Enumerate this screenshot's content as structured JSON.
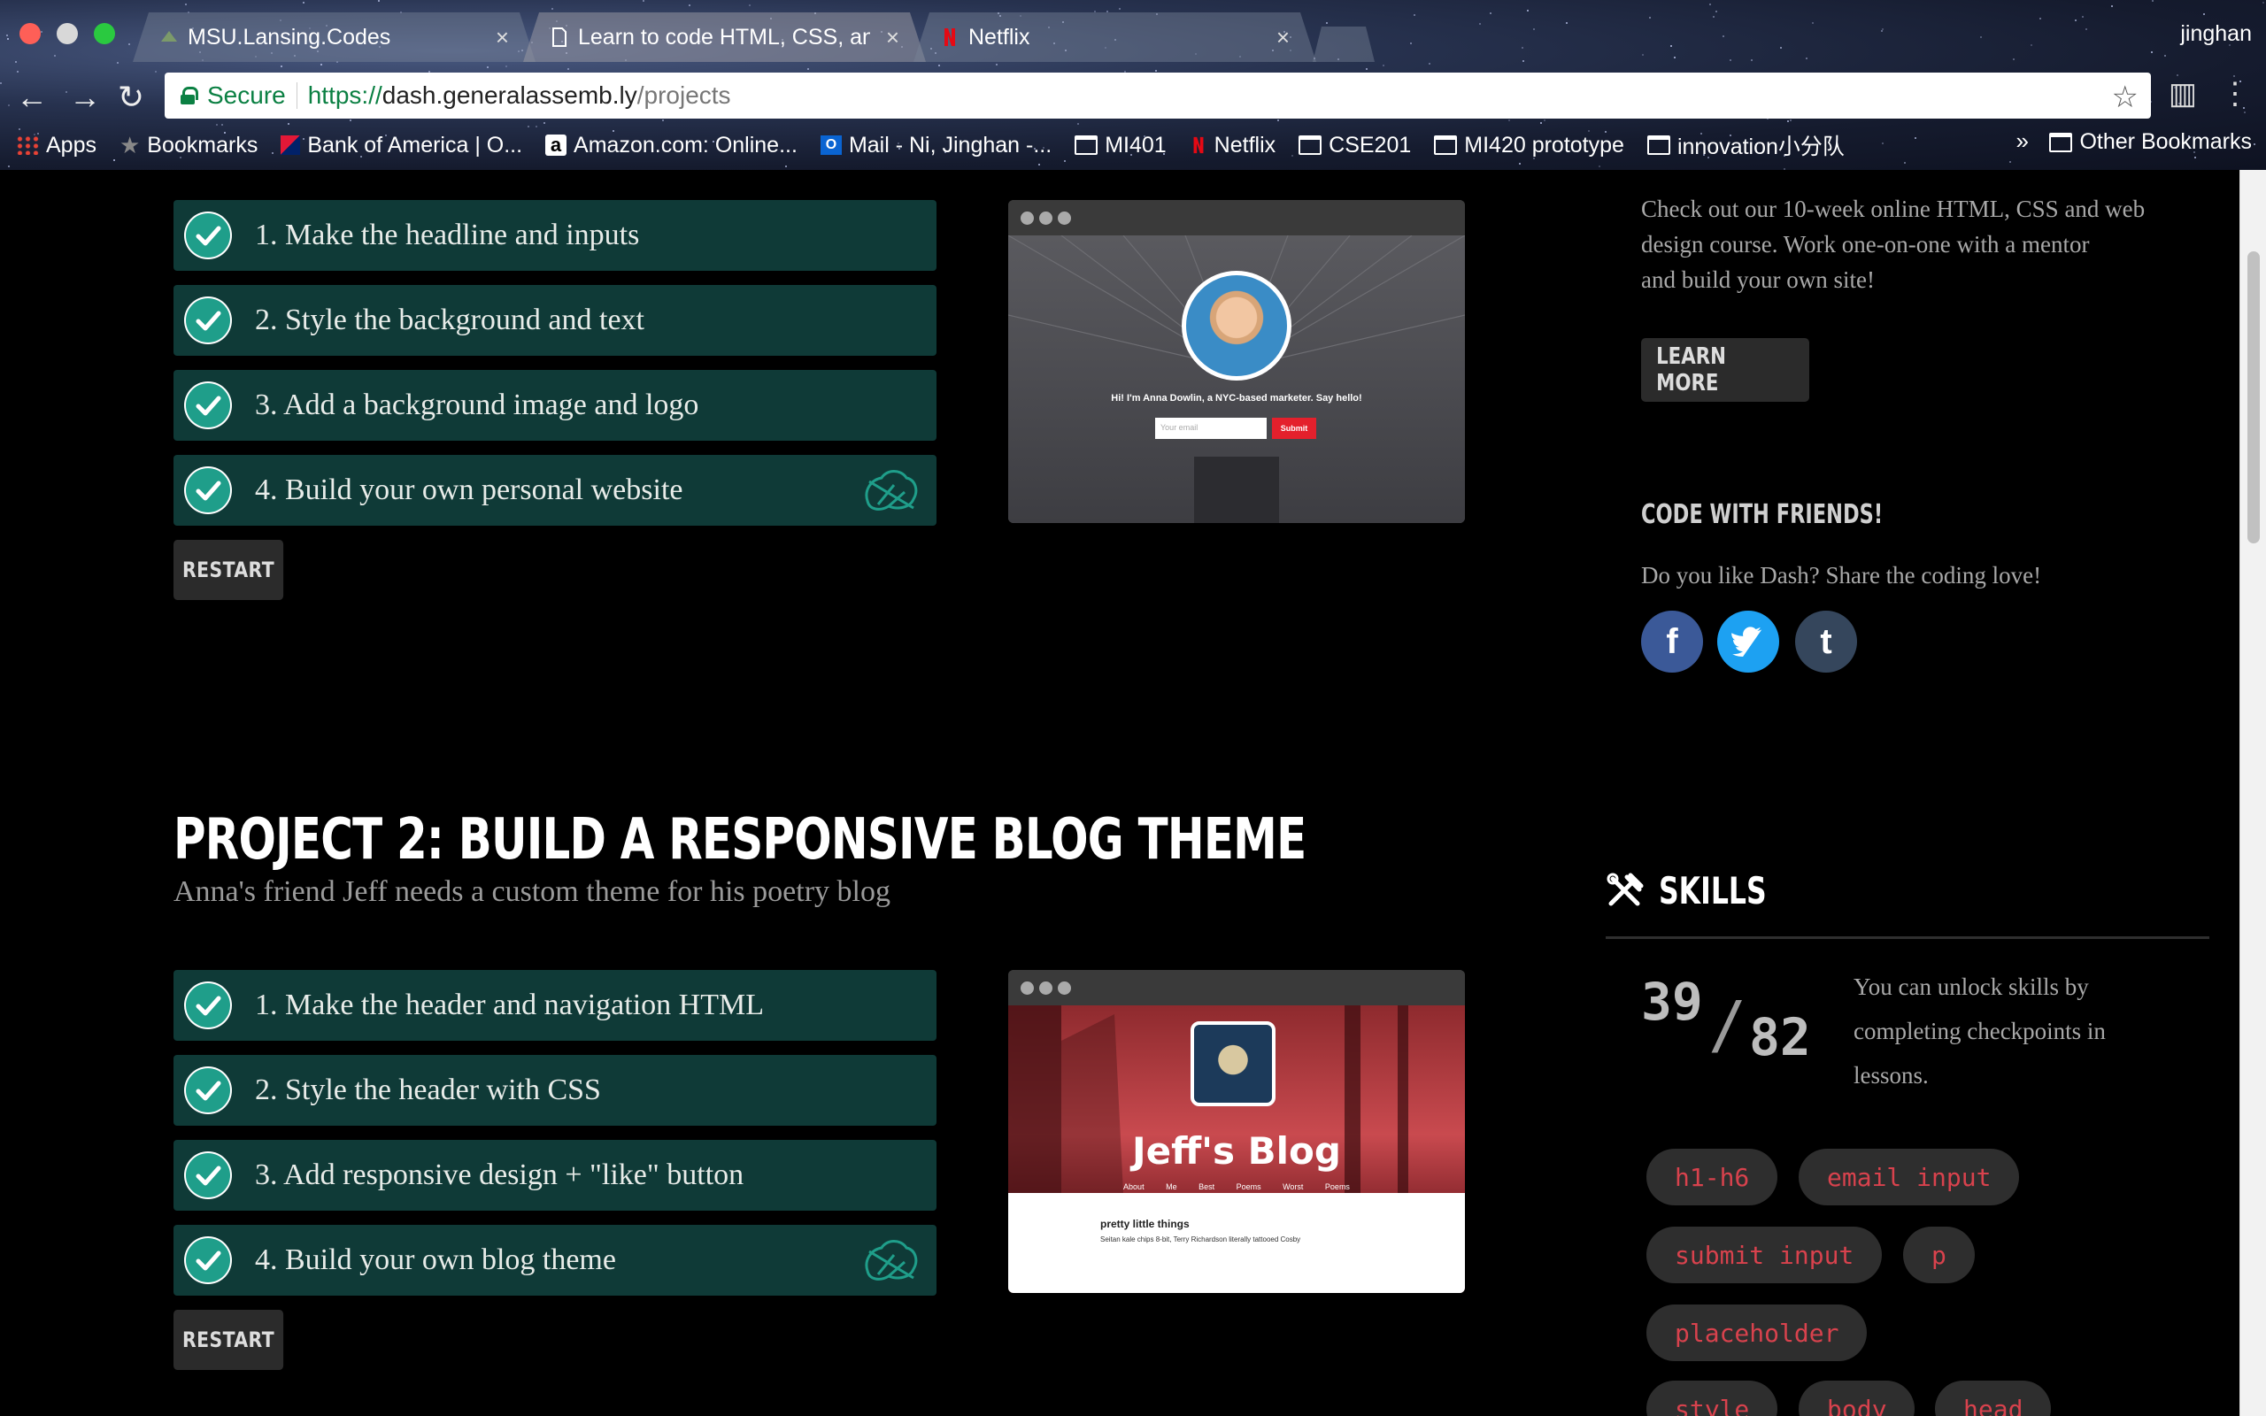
{
  "browser": {
    "user": "jinghan",
    "tabs": [
      {
        "title": "MSU.Lansing.Codes",
        "icon": "site-favicon"
      },
      {
        "title": "Learn to code HTML, CSS, and JavaScript",
        "icon": "document-icon"
      },
      {
        "title": "Netflix",
        "icon": "netflix-icon"
      }
    ],
    "url": {
      "secure_label": "Secure",
      "scheme": "https://",
      "host": "dash.generalassemb.ly",
      "path": "/projects"
    },
    "bookmarks": [
      {
        "label": "Apps",
        "icon": "apps-grid-icon"
      },
      {
        "label": "Bookmarks",
        "icon": "star-icon"
      },
      {
        "label": "Bank of America | O...",
        "icon": "bank-icon"
      },
      {
        "label": "Amazon.com: Online...",
        "icon": "amazon-icon"
      },
      {
        "label": "Mail - Ni, Jinghan -...",
        "icon": "outlook-icon"
      },
      {
        "label": "MI401",
        "icon": "folder-icon"
      },
      {
        "label": "Netflix",
        "icon": "netflix-icon"
      },
      {
        "label": "CSE201",
        "icon": "folder-icon"
      },
      {
        "label": "MI420 prototype",
        "icon": "folder-icon"
      },
      {
        "label": "innovation小分队",
        "icon": "folder-icon"
      }
    ],
    "more_bookmarks": "»",
    "other_bookmarks": "Other Bookmarks"
  },
  "project1": {
    "steps": [
      "1. Make the headline and inputs",
      "2. Style the background and text",
      "3. Add a background image and logo",
      "4. Build your own personal website"
    ],
    "restart_label": "RESTART",
    "preview": {
      "headline": "Hi! I'm Anna Dowlin, a NYC-based marketer. Say hello!",
      "email_placeholder": "Your email",
      "submit_label": "Submit"
    }
  },
  "project2": {
    "title": "PROJECT 2: BUILD A RESPONSIVE BLOG THEME",
    "subtitle": "Anna's friend Jeff needs a custom theme for his poetry blog",
    "steps": [
      "1. Make the header and navigation HTML",
      "2. Style the header with CSS",
      "3. Add responsive design + \"like\" button",
      "4. Build your own blog theme"
    ],
    "restart_label": "RESTART",
    "preview": {
      "blog_title": "Jeff's Blog",
      "nav": "About Me Best Poems Worst Poems",
      "post_title": "pretty little things",
      "post_excerpt": "Seitan kale chips 8-bit, Terry Richardson literally tattooed Cosby"
    }
  },
  "sidebar": {
    "promo_text": "Check out our 10-week online HTML, CSS and web design course. Work one-on-one with a mentor and build your own site!",
    "promo_lines": [
      "Check out our 10-week online HTML, CSS and web",
      "design course. Work one-on-one with a mentor",
      "and build your own site!"
    ],
    "learn_more_label": "LEARN MORE",
    "friends_heading": "CODE WITH FRIENDS!",
    "friends_text": "Do you like Dash? Share the coding love!",
    "social": [
      "f",
      "t"
    ],
    "skills": {
      "heading": "SKILLS",
      "unlocked": "39",
      "total": "82",
      "description_lines": [
        "You can unlock skills by",
        "completing checkpoints in",
        "lessons."
      ],
      "tags": [
        "h1-h6",
        "email input",
        "submit input",
        "p",
        "placeholder",
        "style",
        "body",
        "head"
      ]
    }
  },
  "colors": {
    "step_bg": "#0f3a37",
    "check": "#1f9e8a",
    "tag_text": "#d8424d",
    "button_bg": "#2b2b2b"
  }
}
